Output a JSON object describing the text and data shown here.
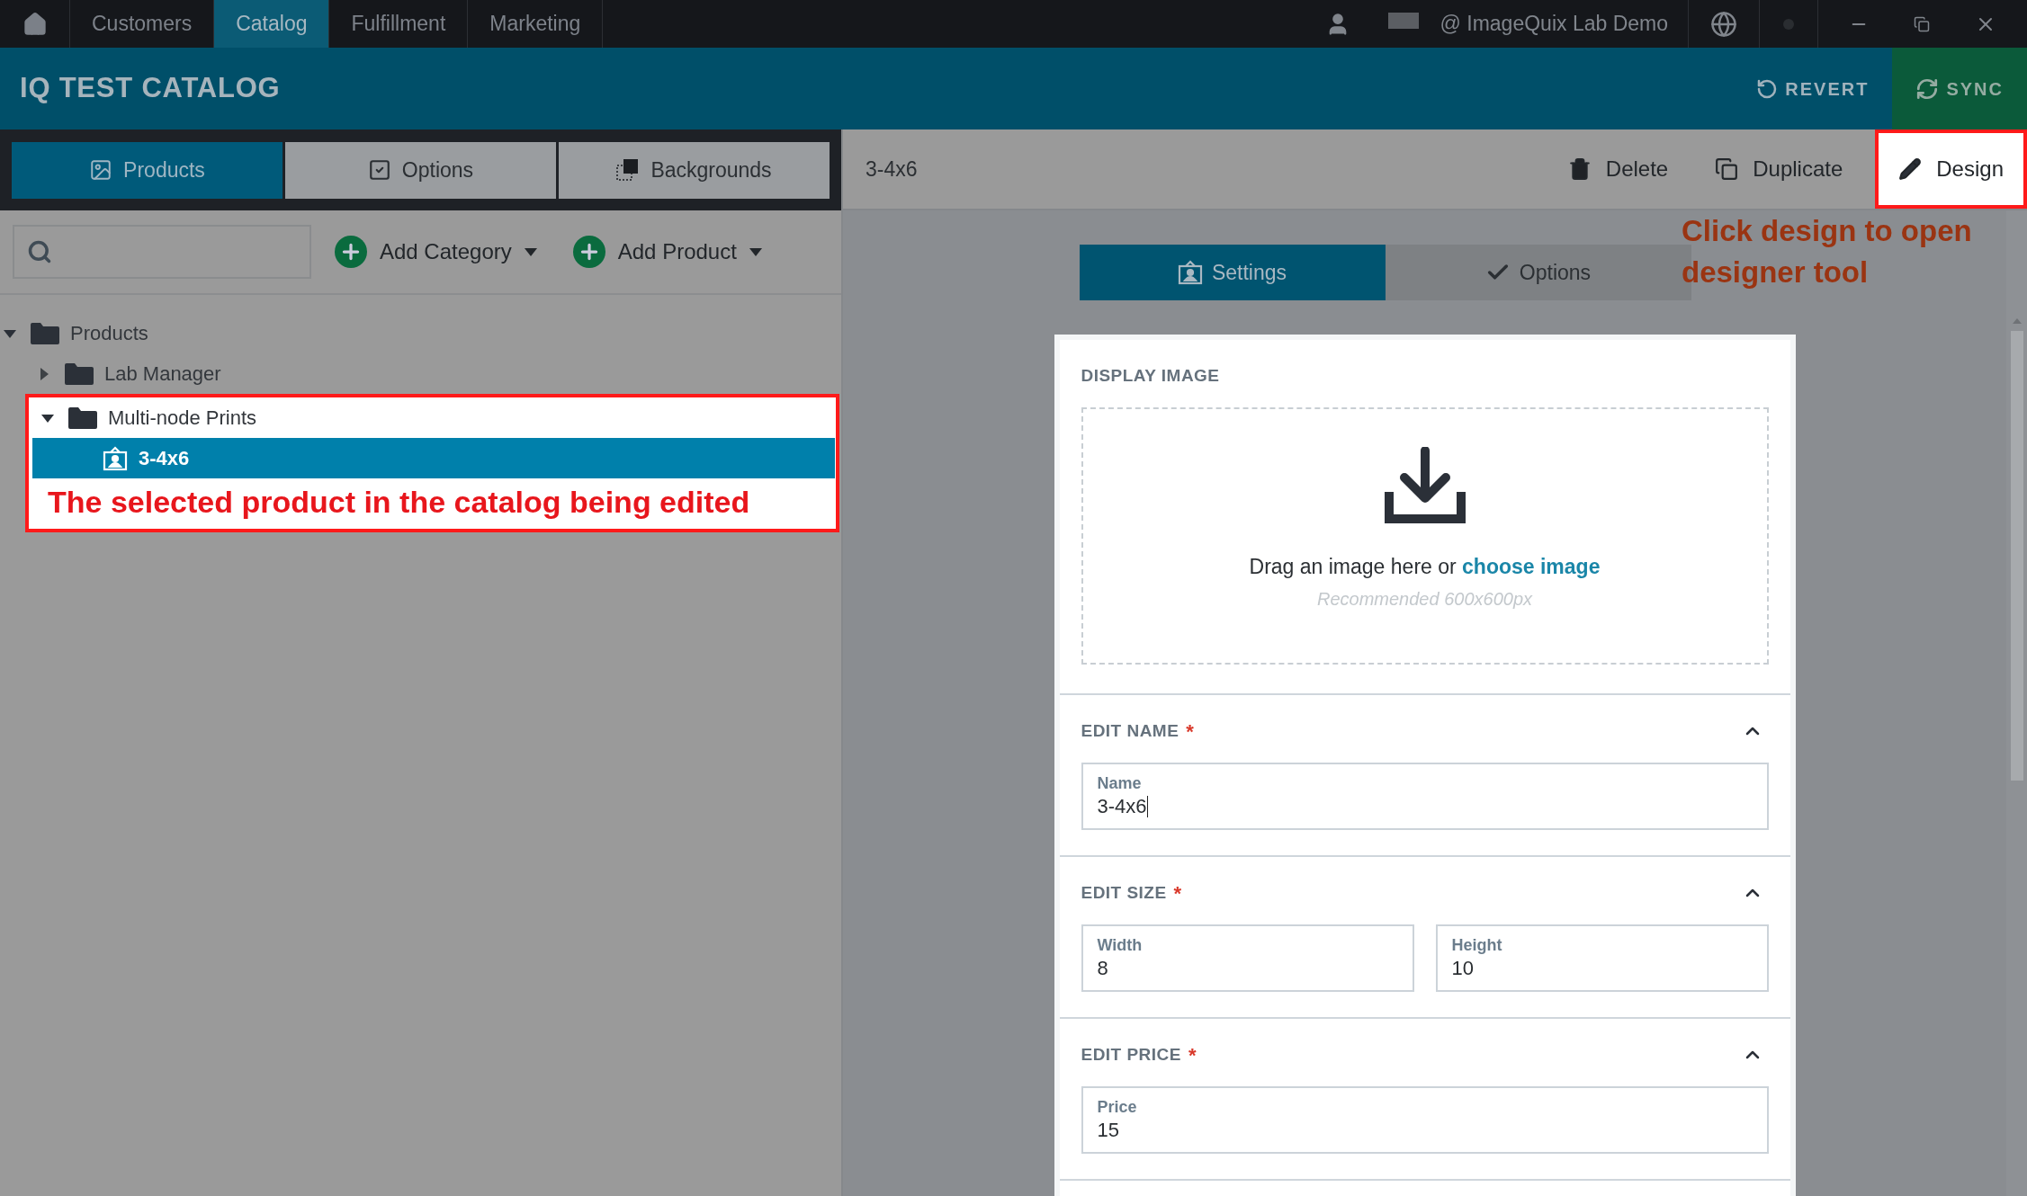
{
  "nav": {
    "tabs": [
      {
        "label": "Customers",
        "selected": false
      },
      {
        "label": "Catalog",
        "selected": true
      },
      {
        "label": "Fulfillment",
        "selected": false
      },
      {
        "label": "Marketing",
        "selected": false
      }
    ],
    "account": "@ ImageQuix Lab Demo"
  },
  "header": {
    "title": "IQ TEST CATALOG",
    "actions": [
      {
        "label": "REVERT",
        "kind": "revert"
      },
      {
        "label": "SYNC",
        "kind": "sync"
      }
    ]
  },
  "left_tabs": [
    {
      "label": "Products",
      "kind": "products",
      "selected": true
    },
    {
      "label": "Options",
      "kind": "options",
      "selected": false
    },
    {
      "label": "Backgrounds",
      "kind": "backgrounds",
      "selected": false
    }
  ],
  "toolbar": {
    "buttons": [
      "Add Category",
      "Add Product"
    ]
  },
  "tree": [
    {
      "label": "Products",
      "kind": "folder",
      "expanded": true,
      "selected": false,
      "children": [
        {
          "label": "Lab Manager",
          "kind": "folder",
          "expanded": false,
          "selected": false
        },
        {
          "label": "Multi-node Prints",
          "kind": "folder",
          "expanded": true,
          "selected": false,
          "callout": "The selected product in the catalog being edited",
          "children": [
            {
              "label": "3-4x6",
              "kind": "product",
              "selected": true
            }
          ]
        }
      ]
    }
  ],
  "editor": {
    "title": "3-4x6",
    "actions": [
      {
        "label": "Delete",
        "kind": "delete"
      },
      {
        "label": "Duplicate",
        "kind": "duplicate"
      },
      {
        "label": "Design",
        "kind": "design",
        "callout": "Click design to open designer tool"
      }
    ],
    "tabs": [
      {
        "label": "Settings",
        "kind": "settings",
        "selected": true
      },
      {
        "label": "Options",
        "kind": "options",
        "selected": false
      }
    ],
    "sections": [
      {
        "kind": "image",
        "title": "DISPLAY IMAGE",
        "prompt": "Drag an image here or",
        "link": "choose image",
        "hint": "Recommended 600x600px"
      },
      {
        "kind": "fields",
        "title": "EDIT NAME",
        "required_mark": "*",
        "expanded": true,
        "fields": [
          {
            "label": "Name",
            "value": "3-4x6",
            "focused": true
          }
        ]
      },
      {
        "kind": "fields",
        "title": "EDIT SIZE",
        "required_mark": "*",
        "expanded": true,
        "fields": [
          {
            "label": "Width",
            "value": "8",
            "focused": false
          },
          {
            "label": "Height",
            "value": "10",
            "focused": false
          }
        ]
      },
      {
        "kind": "fields",
        "title": "EDIT PRICE",
        "required_mark": "*",
        "expanded": true,
        "fields": [
          {
            "label": "Price",
            "value": "15",
            "focused": false
          }
        ]
      }
    ]
  }
}
